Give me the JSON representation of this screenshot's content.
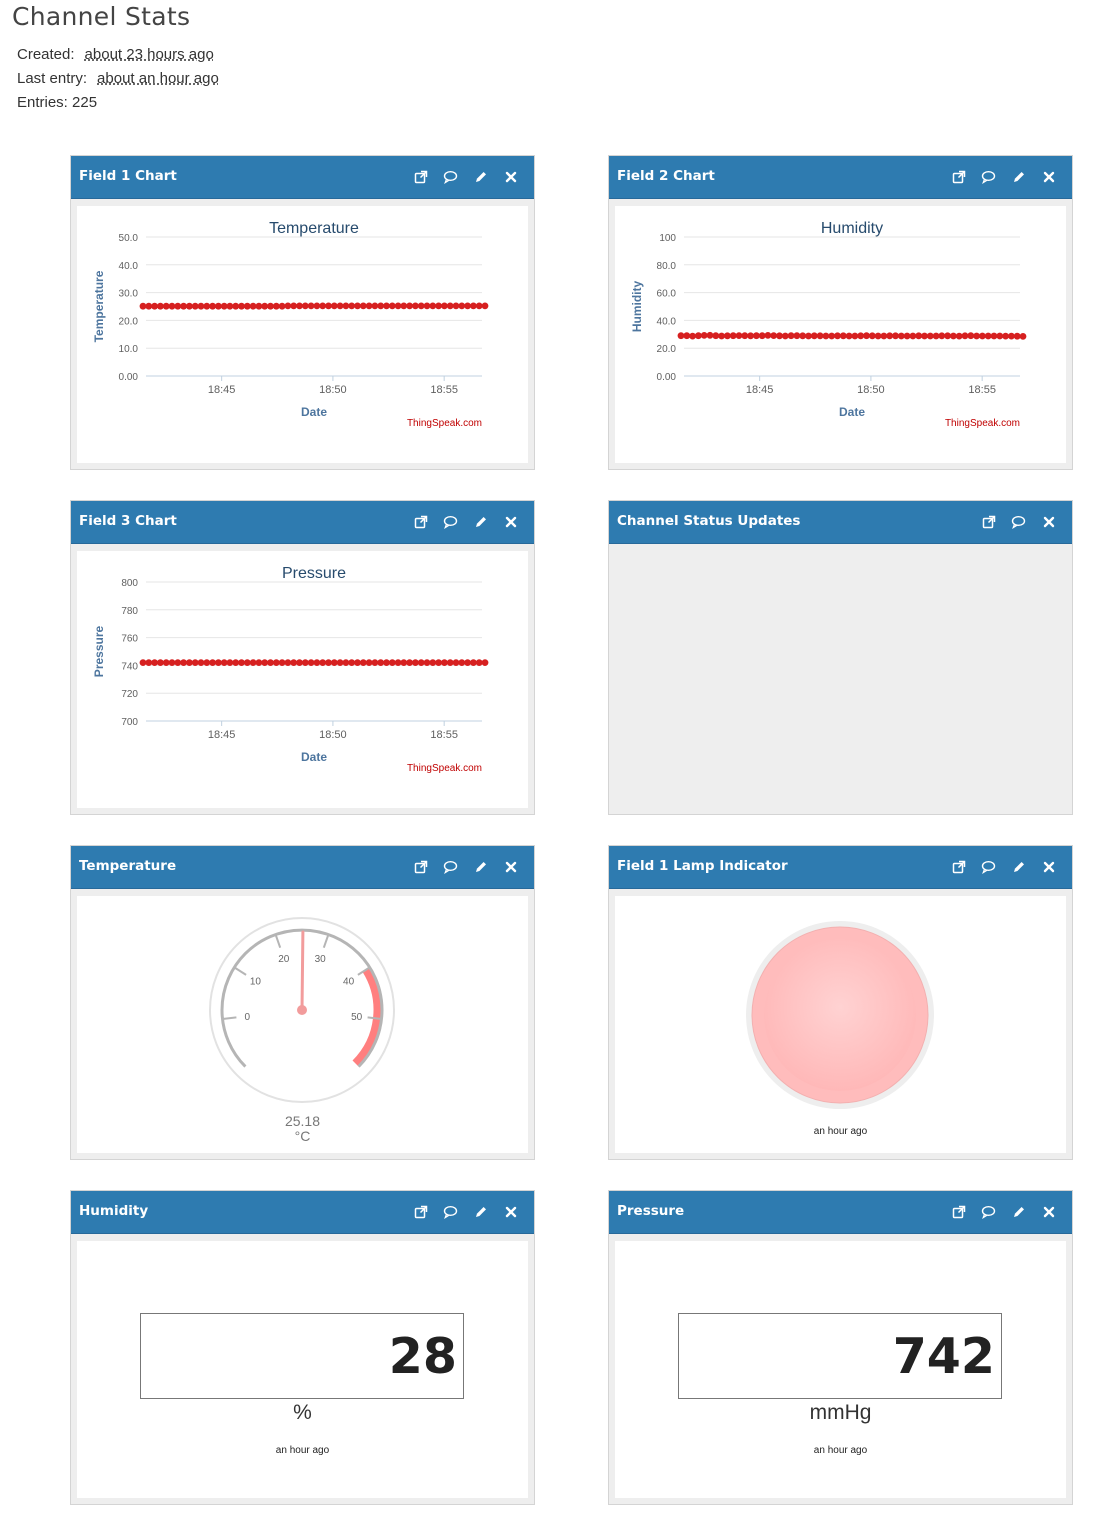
{
  "page": {
    "title": "Channel Stats",
    "created_label": "Created:",
    "created_value": "about 23 hours ago",
    "last_entry_label": "Last entry:",
    "last_entry_value": "about an hour ago",
    "entries_text": "Entries: 225"
  },
  "colors": {
    "header": "#2e7bb0",
    "series": "#d62020",
    "gauge_band": "#ff7f7f",
    "lamp": "#ffbebe"
  },
  "icons": [
    "external-link-icon",
    "comment-icon",
    "pencil-icon",
    "close-icon"
  ],
  "panels": [
    {
      "title": "Field 1 Chart"
    },
    {
      "title": "Field 2 Chart"
    },
    {
      "title": "Field 3 Chart"
    },
    {
      "title": "Channel Status Updates"
    },
    {
      "title": "Temperature"
    },
    {
      "title": "Field 1 Lamp Indicator"
    },
    {
      "title": "Humidity"
    },
    {
      "title": "Pressure"
    }
  ],
  "chart_data": [
    {
      "type": "line",
      "title": "Temperature",
      "xlabel": "Date",
      "ylabel": "Temperature",
      "credit": "ThingSpeak.com",
      "yticks": [
        "0.00",
        "10.0",
        "20.0",
        "30.0",
        "40.0",
        "50.0"
      ],
      "ylim": [
        0,
        50
      ],
      "xticks": [
        "18:45",
        "18:50",
        "18:55"
      ],
      "xtick_minutes": [
        45,
        50,
        55
      ],
      "xlim_minutes": [
        41.6,
        56.7
      ],
      "series": [
        {
          "values": [
            25.1,
            25.1,
            25.1,
            25.1,
            25.1,
            25.1,
            25.1,
            25.1,
            25.1,
            25.1,
            25.1,
            25.1,
            25.1,
            25.1,
            25.1,
            25.1,
            25.1,
            25.1,
            25.1,
            25.1,
            25.1,
            25.1,
            25.1,
            25.1,
            25.1,
            25.2,
            25.2,
            25.2,
            25.2,
            25.2,
            25.2,
            25.2,
            25.2,
            25.2,
            25.2,
            25.2,
            25.2,
            25.2,
            25.2,
            25.2,
            25.2,
            25.2,
            25.2,
            25.2,
            25.2,
            25.2,
            25.2,
            25.2,
            25.2,
            25.2,
            25.2,
            25.2,
            25.2,
            25.2,
            25.2,
            25.2,
            25.2,
            25.2,
            25.2,
            25.2
          ]
        }
      ]
    },
    {
      "type": "line",
      "title": "Humidity",
      "xlabel": "Date",
      "ylabel": "Humidity",
      "credit": "ThingSpeak.com",
      "yticks": [
        "0.00",
        "20.0",
        "40.0",
        "60.0",
        "80.0",
        "100"
      ],
      "ylim": [
        0,
        100
      ],
      "xticks": [
        "18:45",
        "18:50",
        "18:55"
      ],
      "xtick_minutes": [
        45,
        50,
        55
      ],
      "xlim_minutes": [
        41.6,
        56.7
      ],
      "series": [
        {
          "values": [
            29,
            29,
            28.7,
            29,
            29.2,
            29.3,
            29,
            28.8,
            28.9,
            29,
            29.1,
            29,
            28.9,
            29,
            29,
            29.2,
            29.1,
            28.9,
            28.8,
            29,
            29,
            28.9,
            28.8,
            28.9,
            28.9,
            28.8,
            28.8,
            28.9,
            28.9,
            28.8,
            28.8,
            28.9,
            29,
            28.9,
            28.8,
            28.8,
            28.9,
            28.9,
            28.8,
            28.8,
            28.8,
            28.9,
            28.8,
            28.8,
            28.8,
            28.9,
            28.9,
            28.8,
            28.7,
            28.9,
            29,
            28.8,
            28.8,
            28.8,
            28.8,
            28.8,
            28.7,
            28.7,
            28.6,
            28.5
          ]
        }
      ]
    },
    {
      "type": "line",
      "title": "Pressure",
      "xlabel": "Date",
      "ylabel": "Pressure",
      "credit": "ThingSpeak.com",
      "yticks": [
        "700",
        "720",
        "740",
        "760",
        "780",
        "800"
      ],
      "ylim": [
        700,
        800
      ],
      "xticks": [
        "18:45",
        "18:50",
        "18:55"
      ],
      "xtick_minutes": [
        45,
        50,
        55
      ],
      "xlim_minutes": [
        41.6,
        56.7
      ],
      "series": [
        {
          "values": [
            742,
            742,
            742,
            742,
            742,
            742,
            742,
            742,
            742,
            742,
            742,
            742,
            742,
            742,
            742,
            742,
            742,
            742,
            742,
            742,
            742,
            742,
            742,
            742,
            742,
            742,
            742,
            742,
            742,
            742,
            742,
            742,
            742,
            742,
            742,
            742,
            742,
            742,
            742,
            742,
            742,
            742,
            742,
            742,
            742,
            742,
            742,
            742,
            742,
            742,
            742,
            742,
            742,
            742,
            742,
            742,
            742,
            742,
            742,
            742
          ]
        }
      ]
    }
  ],
  "gauge": {
    "value": 25.18,
    "value_text": "25.18",
    "unit": "°C",
    "min": -10,
    "max": 60,
    "tick_values": [
      0,
      10,
      20,
      30,
      40,
      50
    ],
    "tick_labels": [
      "0",
      "10",
      "20",
      "30",
      "40",
      "50"
    ],
    "band": [
      40,
      60
    ]
  },
  "lamp": {
    "time": "an hour ago"
  },
  "humidity_display": {
    "value": "28",
    "unit": "%",
    "time": "an hour ago"
  },
  "pressure_display": {
    "value": "742",
    "unit": "mmHg",
    "time": "an hour ago"
  }
}
